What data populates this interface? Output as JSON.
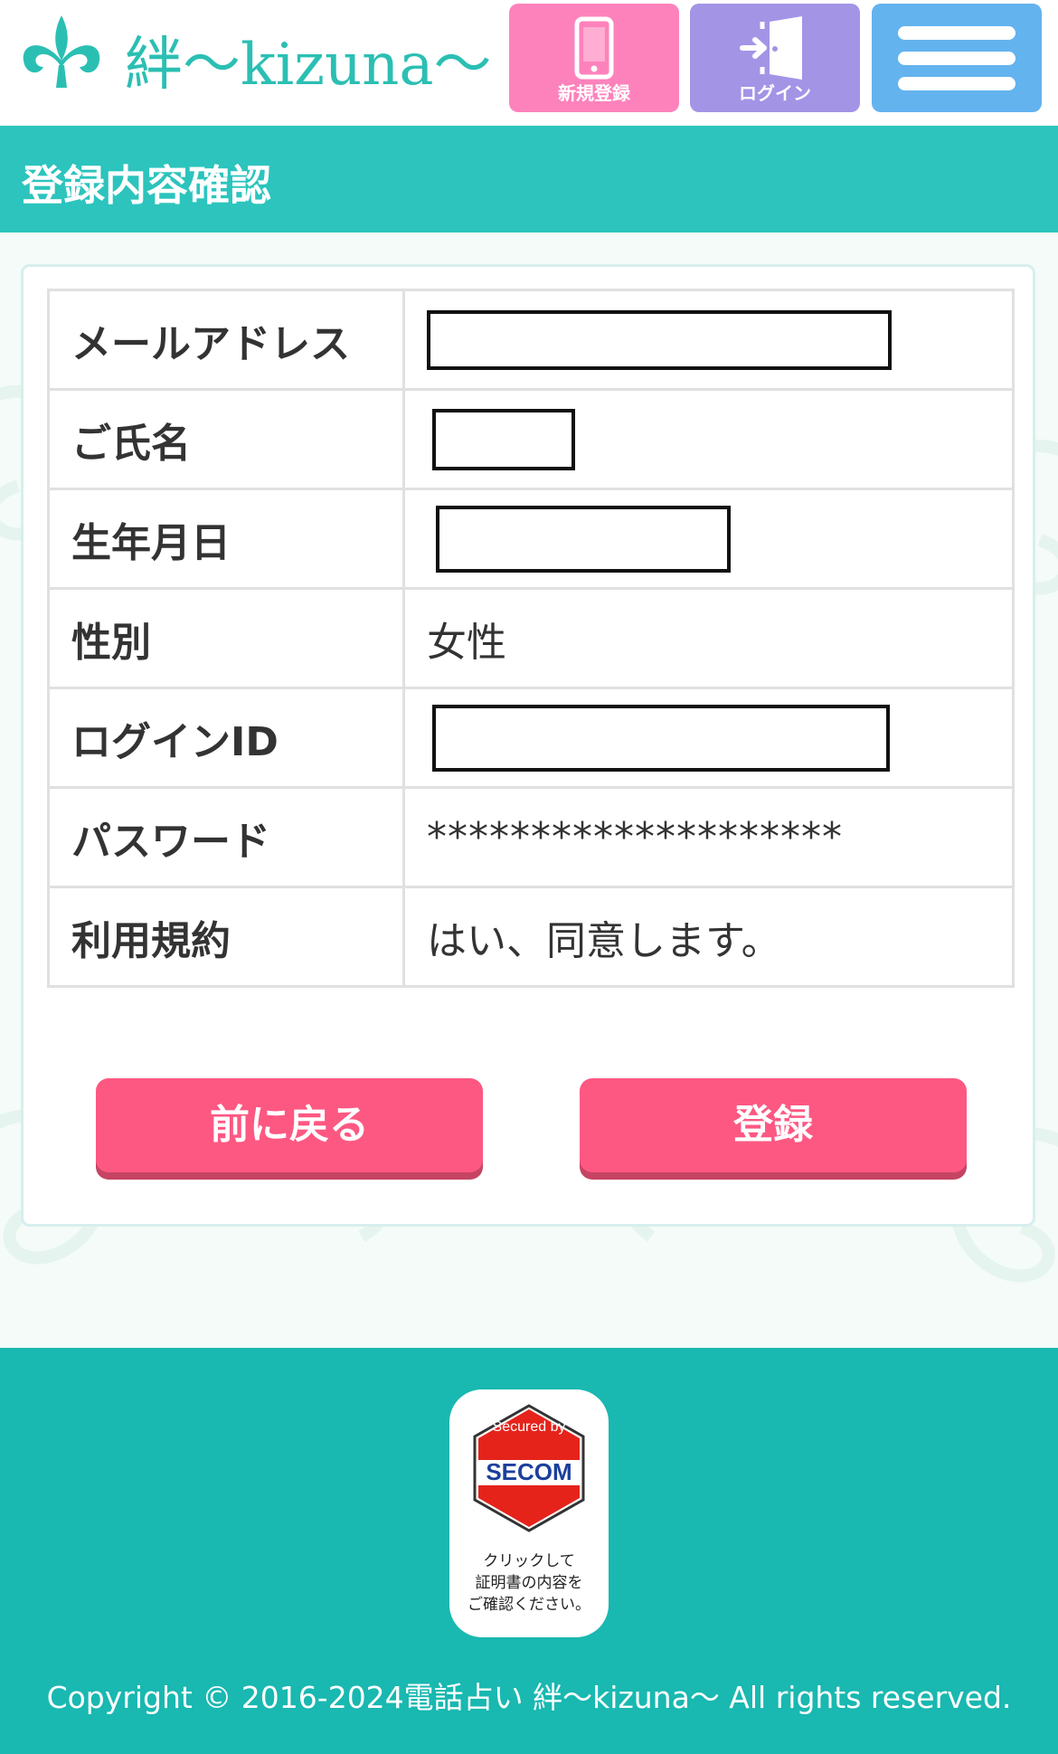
{
  "header": {
    "logo_text": "絆～kizuna～",
    "register_label": "新規登録",
    "login_label": "ログイン",
    "colors": {
      "register": "#fd82bc",
      "login": "#a394e6",
      "menu": "#63b3ef"
    }
  },
  "page_title": "登録内容確認",
  "rows": [
    {
      "label": "メールアドレス",
      "value": ""
    },
    {
      "label": "ご氏名",
      "value": ""
    },
    {
      "label": "生年月日",
      "value": ""
    },
    {
      "label": "性別",
      "value": "女性"
    },
    {
      "label": "ログインID",
      "value": ""
    },
    {
      "label": "パスワード",
      "value": "********************"
    },
    {
      "label": "利用規約",
      "value": "はい、同意します。"
    }
  ],
  "buttons": {
    "back": "前に戻る",
    "submit": "登録"
  },
  "footer": {
    "badge_top": "Secured by",
    "badge_brand": "SECOM",
    "badge_note": [
      "クリックして",
      "証明書の内容を",
      "ご確認ください。"
    ],
    "copyright": "Copyright © 2016-2024電話占い 絆～kizuna～ All rights reserved."
  }
}
